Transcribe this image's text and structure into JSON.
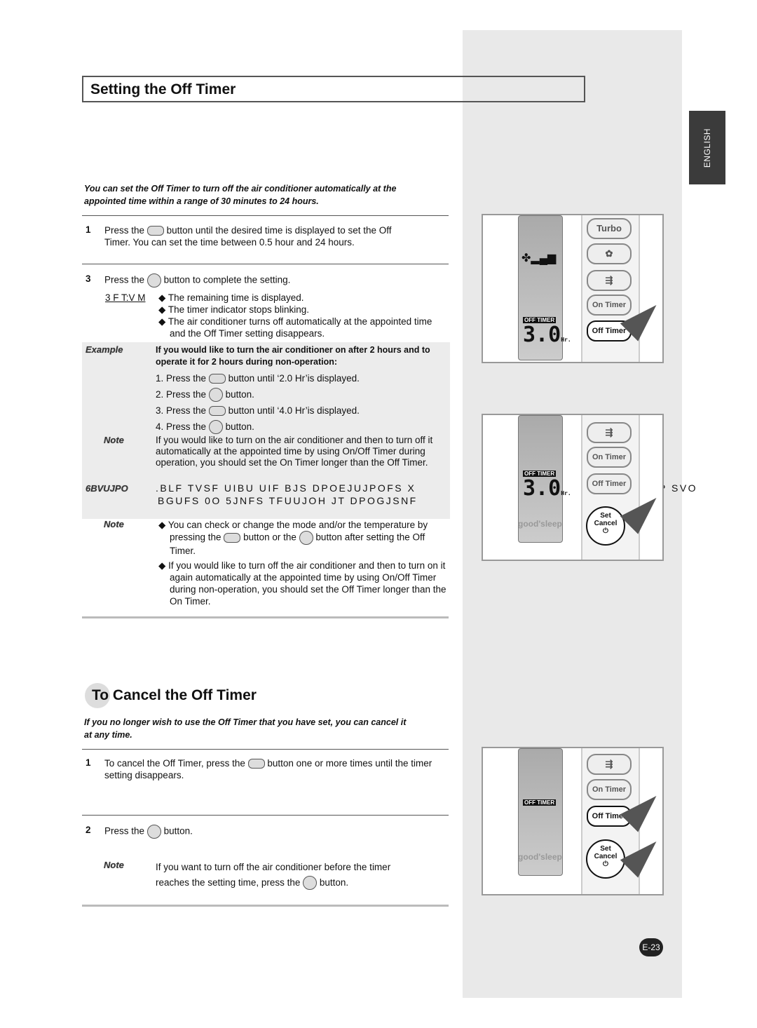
{
  "tab": "ENGLISH",
  "title": "Setting the Off Timer",
  "intro": "You can set the Off Timer to turn off the air conditioner automatically at the appointed time within a range of 30 minutes to 24 hours.",
  "step1": {
    "num": "1",
    "pre": "Press the",
    "btn": "Off Timer",
    "post": "button until the desired time is displayed to set the Off Timer. You can set the time between 0.5 hour and 24 hours."
  },
  "step3": {
    "num": "3",
    "pre": "Press the",
    "btn": "Set Cancel",
    "post": "button to complete the setting."
  },
  "result_label": "3 F T:V M",
  "results": [
    "The remaining time is displayed.",
    "The timer indicator stops blinking.",
    "The air conditioner turns off automatically at the appointed time and the Off Timer setting disappears."
  ],
  "example": {
    "label": "Example",
    "heading": "If you would like to turn the air conditioner on after 2 hours and to operate it for 2 hours during non-operation:",
    "steps": [
      {
        "pre": "1. Press the",
        "btn": "On Timer",
        "post": "button until ‘2.0 Hr’is displayed."
      },
      {
        "pre": "2. Press the",
        "btn": "Set Cancel",
        "post": "button."
      },
      {
        "pre": "3. Press the",
        "btn": "Off Timer",
        "post": "button until ‘4.0 Hr’is displayed."
      },
      {
        "pre": "4. Press the",
        "btn": "Set Cancel",
        "post": "button."
      }
    ]
  },
  "note1": {
    "label": "Note",
    "text": "If you would like to turn on the air conditioner and then to turn off it automatically at the appointed time by using On/Off Timer during operation, you should set the On Timer longer than the Off Timer."
  },
  "caution": {
    "label": "6BVUJPO",
    "line1": ".BLF TVSF UIBU UIF BJS DPOEJUJPOFS X",
    "line1_tail": "P SVO",
    "line2": "BGUFS 0O 5JNFS TFUUJOH JT DPOGJSNF"
  },
  "note2": {
    "label": "Note",
    "b1_pre": "You can check or change the mode and/or the temperature by pressing the",
    "b1_btn": "Mode",
    "b1_mid": "button or the",
    "b1_post": "button after setting the Off Timer.",
    "b2": "If you would like to turn off the air conditioner and then to turn on it again automatically at the appointed time by using On/Off Timer during non-operation, you should set the Off Timer longer than the On Timer."
  },
  "cancel": {
    "title": "To Cancel the Off Timer",
    "intro": "If you no longer wish to use the Off Timer that you have set, you can cancel it at any time.",
    "step1": {
      "num": "1",
      "pre": "To cancel the Off Timer, press the",
      "btn": "Off Timer",
      "post": "button one or more times until the timer setting disappears."
    },
    "step2": {
      "num": "2",
      "pre": "Press the",
      "post": "button."
    },
    "note": {
      "label": "Note",
      "pre": "If you want to turn off the air conditioner before the timer reaches the setting time, press the",
      "post": "button."
    }
  },
  "remote": {
    "off_timer": "OFF TIMER",
    "display": "3.0",
    "unit": "Hr.",
    "turbo": "Turbo",
    "on_timer": "On Timer",
    "off_timer_btn": "Off Timer",
    "set": "Set",
    "cancel": "Cancel",
    "brand": "good'sleep"
  },
  "page": "E-23"
}
